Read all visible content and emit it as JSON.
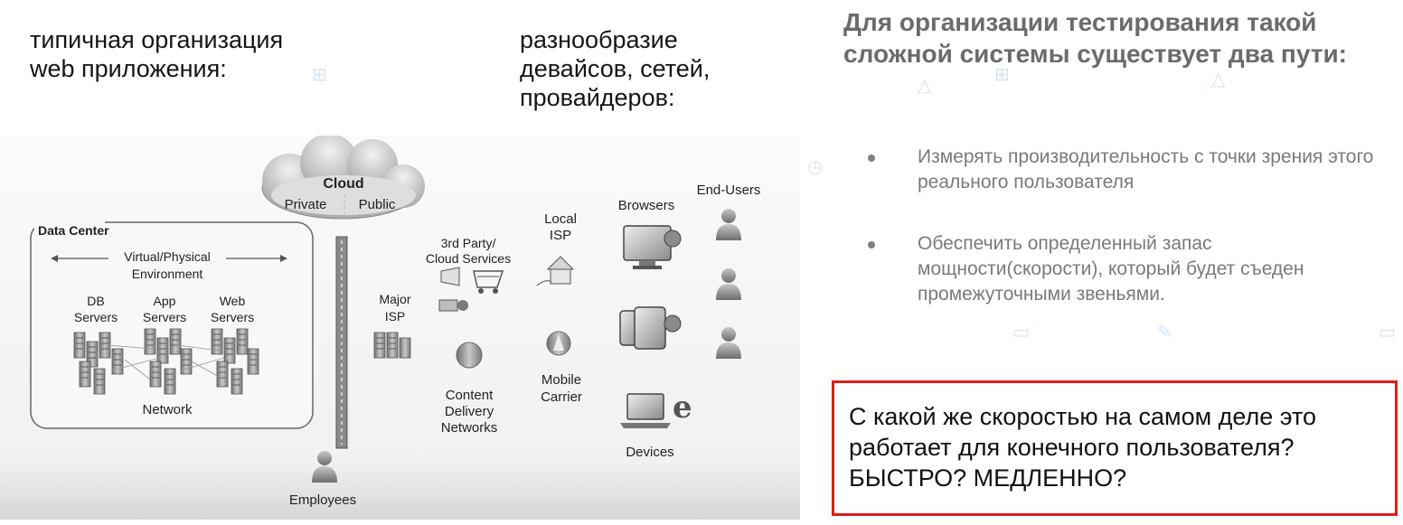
{
  "captions": {
    "left": "типичная организация web приложения:",
    "middle": "разнообразие девайсов, сетей, провайдеров:"
  },
  "diagram": {
    "cloud": {
      "title": "Cloud",
      "private": "Private",
      "public": "Public"
    },
    "data_center": {
      "title": "Data Center",
      "virtual_physical": "Virtual/Physical",
      "environment": "Environment",
      "db_servers": [
        "DB",
        "Servers"
      ],
      "app_servers": [
        "App",
        "Servers"
      ],
      "web_servers": [
        "Web",
        "Servers"
      ],
      "network": "Network"
    },
    "major_isp": [
      "Major",
      "ISP"
    ],
    "third_party": [
      "3rd Party/",
      "Cloud Services"
    ],
    "cdn": [
      "Content",
      "Delivery",
      "Networks"
    ],
    "local_isp": [
      "Local",
      "ISP"
    ],
    "mobile_carrier": [
      "Mobile",
      "Carrier"
    ],
    "browsers": "Browsers",
    "devices": "Devices",
    "end_users": "End-Users",
    "employees": "Employees"
  },
  "heading": "Для организации тестирования такой сложной системы существует два пути:",
  "bullets": [
    "Измерять производительность с точки зрения этого реального пользователя",
    "Обеспечить определенный запас мощности(скорости), который будет съеден промежуточными звеньями."
  ],
  "callout": "С какой же скоростью на самом деле это работает для конечного пользователя? БЫСТРО? МЕДЛЕННО?",
  "colors": {
    "callout_border": "#e11b1b",
    "heading": "#6b6b6b",
    "bullet_text": "#7a7a7a"
  }
}
